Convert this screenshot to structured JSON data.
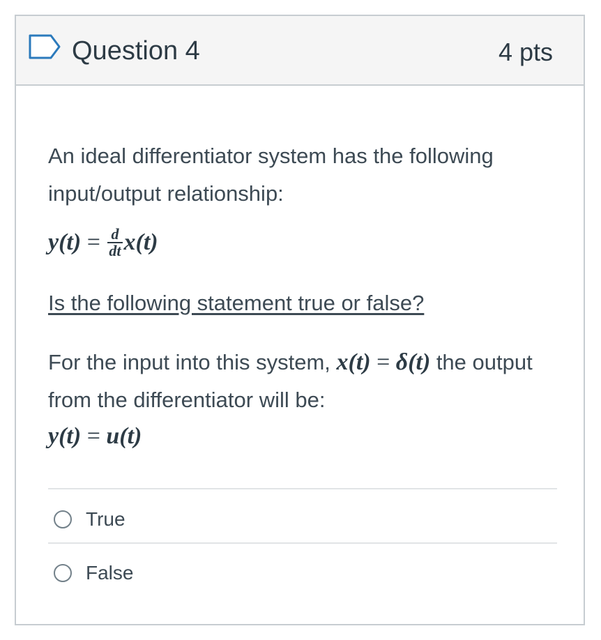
{
  "question": {
    "title": "Question 4",
    "points": "4 pts",
    "intro": "An ideal differentiator system has the following input/output relationship:",
    "equation1": {
      "lhs": "y(t)",
      "equals": "=",
      "frac_num": "d",
      "frac_den": "dt",
      "rhs": "x(t)"
    },
    "prompt": "Is the following statement true or false?",
    "statement": {
      "text_before": "For the input into this system, ",
      "math_lhs": "x(t)",
      "equals": "=",
      "math_rhs": "δ(t)",
      "text_after": " the output from the differentiator will be:"
    },
    "equation2": {
      "lhs": "y(t)",
      "equals": "=",
      "rhs": "u(t)"
    }
  },
  "answers": [
    {
      "label": "True",
      "selected": false
    },
    {
      "label": "False",
      "selected": false
    }
  ],
  "colors": {
    "header_bg": "#f5f5f5",
    "border": "#c7cdd1",
    "flag_outline": "#2b7abc",
    "text": "#2d3b45"
  },
  "icons": {
    "header_flag": "bookmark-flag-icon"
  }
}
